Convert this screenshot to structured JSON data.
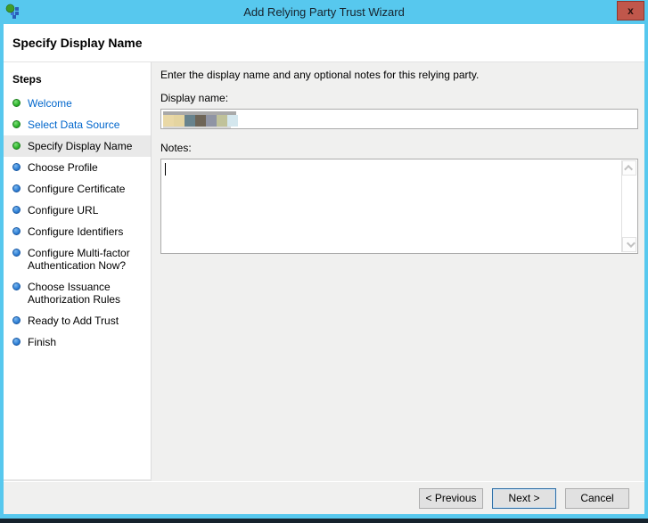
{
  "window": {
    "title": "Add Relying Party Trust Wizard",
    "close_label": "x"
  },
  "header": {
    "title": "Specify Display Name"
  },
  "sidebar": {
    "title": "Steps",
    "items": [
      {
        "label": "Welcome",
        "status": "done"
      },
      {
        "label": "Select Data Source",
        "status": "done"
      },
      {
        "label": "Specify Display Name",
        "status": "current"
      },
      {
        "label": "Choose Profile",
        "status": "pending"
      },
      {
        "label": "Configure Certificate",
        "status": "pending"
      },
      {
        "label": "Configure URL",
        "status": "pending"
      },
      {
        "label": "Configure Identifiers",
        "status": "pending"
      },
      {
        "label": "Configure Multi-factor Authentication Now?",
        "status": "pending"
      },
      {
        "label": "Choose Issuance Authorization Rules",
        "status": "pending"
      },
      {
        "label": "Ready to Add Trust",
        "status": "pending"
      },
      {
        "label": "Finish",
        "status": "pending"
      }
    ]
  },
  "main": {
    "instruction": "Enter the display name and any optional notes for this relying party.",
    "display_name_label": "Display name:",
    "display_name_value": "",
    "display_name_redaction": {
      "note": "value is pixelated/redacted in screenshot",
      "top_bar_color": "#a9a9a9",
      "bottom_bar_color": "#d9d9d9",
      "blocks": [
        "#e9d8a6",
        "#e4d4a0",
        "#68838d",
        "#6e6557",
        "#8f94a4",
        "#c0c29a",
        "#d4e7ee",
        "#ffffff"
      ]
    },
    "notes_label": "Notes:",
    "notes_value": ""
  },
  "buttons": {
    "previous": "< Previous",
    "next": "Next >",
    "cancel": "Cancel"
  },
  "colors": {
    "frame": "#57c8ee",
    "close": "#c0574b",
    "link": "#0066cc",
    "done_dot": "#2db52c",
    "pending_dot": "#2f80d6",
    "dark_strip": "#16222c"
  }
}
